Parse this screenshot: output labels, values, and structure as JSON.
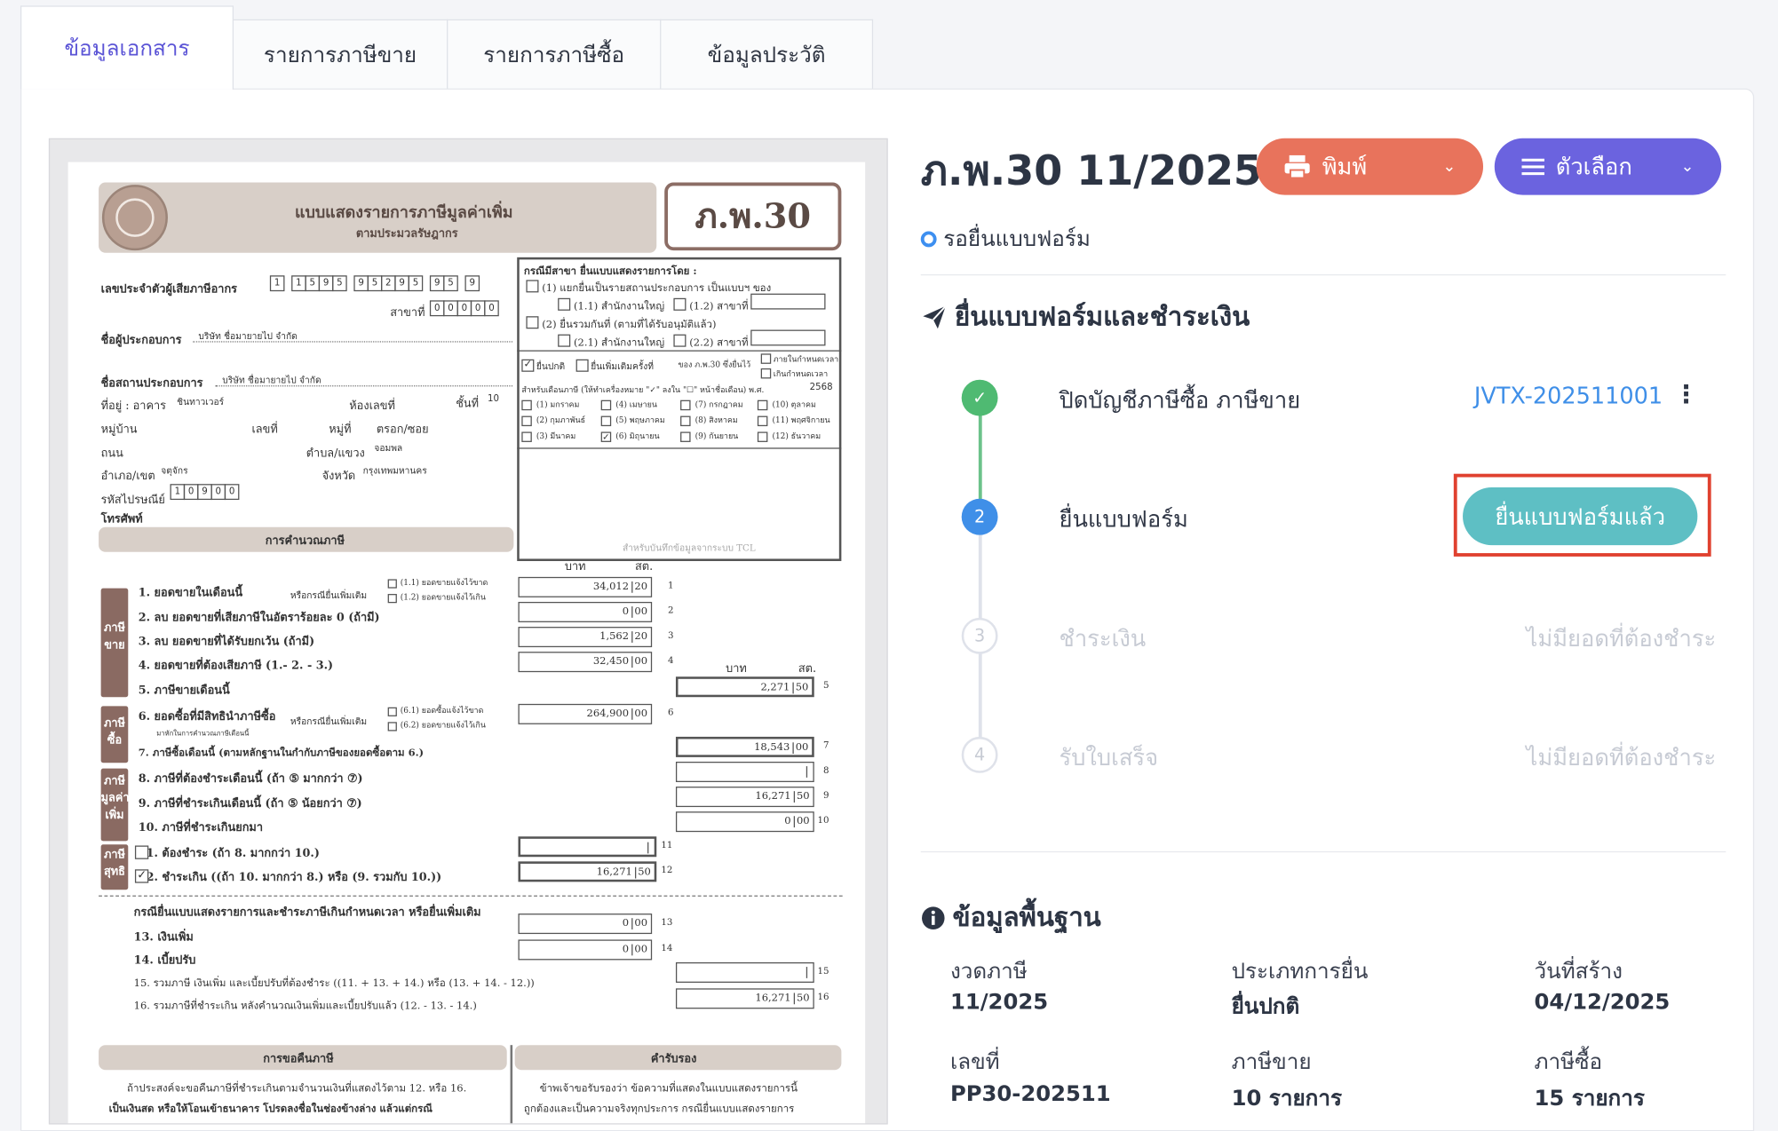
{
  "tabs": [
    "ข้อมูลเอกสาร",
    "รายการภาษีขาย",
    "รายการภาษีซื้อ",
    "ข้อมูลประวัติ"
  ],
  "doc_title": "ภ.พ.30 11/2025",
  "print_label": "พิมพ์",
  "options_label": "ตัวเลือก",
  "status": "รอยื่นแบบฟอร์ม",
  "section_submit": "ยื่นแบบฟอร์มและชำระเงิน",
  "steps": [
    {
      "num": "✓",
      "label": "ปิดบัญชีภาษีซื้อ ภาษีขาย",
      "value": "JVTX-202511001"
    },
    {
      "num": "2",
      "label": "ยื่นแบบฟอร์ม",
      "value": "ยื่นแบบฟอร์มแล้ว"
    },
    {
      "num": "3",
      "label": "ชำระเงิน",
      "value": "ไม่มียอดที่ต้องชำระ"
    },
    {
      "num": "4",
      "label": "รับใบเสร็จ",
      "value": "ไม่มียอดที่ต้องชำระ"
    }
  ],
  "section_basic": "ข้อมูลพื้นฐาน",
  "basic": [
    {
      "k": "งวดภาษี",
      "v": "11/2025"
    },
    {
      "k": "ประเภทการยื่น",
      "v": "ยื่นปกติ"
    },
    {
      "k": "วันที่สร้าง",
      "v": "04/12/2025"
    },
    {
      "k": "เลขที่",
      "v": "PP30-202511"
    },
    {
      "k": "ภาษีขาย",
      "v": "10 รายการ"
    },
    {
      "k": "ภาษีซื้อ",
      "v": "15 รายการ"
    }
  ],
  "form": {
    "header": "แบบแสดงรายการภาษีมูลค่าเพิ่ม",
    "subheader": "ตามประมวลรัษฎากร",
    "code": "ภ.พ.30",
    "taxid_label": "เลขประจำตัวผู้เสียภาษีอากร",
    "taxid": [
      "1",
      "1",
      "5",
      "9",
      "5",
      "9",
      "5",
      "2",
      "9",
      "5",
      "9",
      "5",
      "9"
    ],
    "branch_label": "สาขาที่",
    "branch": [
      "0",
      "0",
      "0",
      "0",
      "0"
    ],
    "operator_label": "ชื่อผู้ประกอบการ",
    "operator": "บริษัท ชื่อมายายไป จำกัด",
    "place_label": "ชื่อสถานประกอบการ",
    "place": "บริษัท ชื่อมายายไป จำกัด",
    "addr_building_label": "ที่อยู่ : อาคาร",
    "addr_building": "ชินทาวเวอร์",
    "room_label": "ห้องเลขที่",
    "floor_label": "ชั้นที่",
    "floor": "10",
    "village_label": "หมู่บ้าน",
    "no_label": "เลขที่",
    "moo_label": "หมู่ที่",
    "soi_label": "ตรอก/ซอย",
    "road_label": "ถนน",
    "subdistrict_label": "ตำบล/แขวง",
    "subdistrict": "จอมพล",
    "district_label": "อำเภอ/เขต",
    "district": "จตุจักร",
    "province_label": "จังหวัด",
    "province": "กรุงเทพมหานคร",
    "postal_label": "รหัสไปรษณีย์",
    "postal": [
      "1",
      "0",
      "9",
      "0",
      "0"
    ],
    "phone_label": "โทรศัพท์",
    "branch_case": "กรณีมีสาขา ยื่นแบบแสดงรายการโดย :",
    "opt1": "(1) แยกยื่นเป็นรายสถานประกอบการ เป็นแบบฯ ของ",
    "opt11": "(1.1) สำนักงานใหญ่",
    "opt12": "(1.2) สาขาที่",
    "opt2": "(2) ยื่นรวมกันที่ (ตามที่ได้รับอนุมัติแล้ว)",
    "opt21": "(2.1) สำนักงานใหญ่",
    "opt22": "(2.2) สาขาที่",
    "normal": "ยื่นปกติ",
    "extra": "ยื่นเพิ่มเติมครั้งที่",
    "pp30of": "ของ ภ.พ.30 ซึ่งยื่นไว้",
    "within": "ภายในกำหนดเวลา",
    "over": "เกินกำหนดเวลา",
    "month_hdr": "สำหรับเดือนภาษี (ให้ทำเครื่องหมาย \"✓\" ลงใน \"☐\" หน้าชื่อเดือน) พ.ศ.",
    "year": "2568",
    "months": [
      "(1) มกราคม",
      "(4) เมษายน",
      "(7) กรกฎาคม",
      "(10) ตุลาคม",
      "(2) กุมภาพันธ์",
      "(5) พฤษภาคม",
      "(8) สิงหาคม",
      "(11) พฤศจิกายน",
      "(3) มีนาคม",
      "(6) มิถุนายน",
      "(9) กันยายน",
      "(12) ธันวาคม"
    ],
    "tcl": "สำหรับบันทึกข้อมูลจากระบบ TCL",
    "calc": "การคำนวณภาษี",
    "baht": "บาท",
    "satang": "สต.",
    "side_sale": [
      "ภาษี",
      "ขาย"
    ],
    "side_buy": [
      "ภาษี",
      "ซื้อ"
    ],
    "side_vat": [
      "ภาษี",
      "มูลค่า",
      "เพิ่ม"
    ],
    "side_net": [
      "ภาษี",
      "สุทธิ"
    ],
    "or_extra": "หรือกรณียื่นเพิ่มเติม",
    "r11": "(1.1) ยอดขายแจ้งไว้ขาด",
    "r12": "(1.2) ยอดขายแจ้งไว้เกิน",
    "r61": "(6.1) ยอดซื้อแจ้งไว้ขาด",
    "r62": "(6.2) ยอดขายแจ้งไว้เกิน",
    "r6note": "มาหักในการคำนวณภาษีเดือนนี้",
    "lines": [
      "1. ยอดขายในเดือนนี้",
      "2. ลบ ยอดขายที่เสียภาษีในอัตราร้อยละ 0 (ถ้ามี)",
      "3. ลบ ยอดขายที่ได้รับยกเว้น (ถ้ามี)",
      "4. ยอดขายที่ต้องเสียภาษี (1.- 2. - 3.)",
      "5. ภาษีขายเดือนนี้",
      "6. ยอดซื้อที่มีสิทธินำภาษีซื้อ",
      "7. ภาษีซื้อเดือนนี้ (ตามหลักฐานในกำกับภาษีของยอดซื้อตาม 6.)",
      "8. ภาษีที่ต้องชำระเดือนนี้ (ถ้า ⑤ มากกว่า ⑦)",
      "9. ภาษีที่ชำระเกินเดือนนี้ (ถ้า ⑤ น้อยกว่า ⑦)",
      "10. ภาษีที่ชำระเกินยกมา",
      "11. ต้องชำระ (ถ้า 8. มากกว่า 10.)",
      "12. ชำระเกิน ((ถ้า 10. มากกว่า 8.) หรือ (9. รวมกับ 10.))"
    ],
    "vals": {
      "v1": "34,012",
      "s1": "20",
      "v2": "0",
      "s2": "00",
      "v3": "1,562",
      "s3": "20",
      "v4": "32,450",
      "s4": "00",
      "v5": "2,271",
      "s5": "50",
      "v6": "264,900",
      "s6": "00",
      "v7": "18,543",
      "s7": "00",
      "v9": "16,271",
      "s9": "50",
      "v10": "0",
      "s10": "00",
      "v12": "16,271",
      "s12": "50"
    },
    "late_hdr": "กรณียื่นแบบแสดงรายการและชำระภาษีเกินกำหนดเวลา หรือยื่นเพิ่มเติม",
    "l13": "13. เงินเพิ่ม",
    "l14": "14. เบี้ยปรับ",
    "l15": "15. รวมภาษี เงินเพิ่ม และเบี้ยปรับที่ต้องชำระ ((11. + 13. + 14.) หรือ (13. + 14. - 12.))",
    "l16": "16. รวมภาษีที่ชำระเกิน หลังคำนวณเงินเพิ่มและเบี้ยปรับแล้ว (12. - 13. - 14.)",
    "v13": "0",
    "s13": "00",
    "v14": "0",
    "s14": "00",
    "v16": "16,271",
    "s16": "50",
    "refund_hdr": "การขอคืนภาษี",
    "cert_hdr": "คำรับรอง",
    "refund_t1": "ถ้าประสงค์จะขอคืนภาษีที่ชำระเกินตามจำนวนเงินที่แสดงไว้ตาม 12. หรือ 16.",
    "refund_t2": "เป็นเงินสด หรือให้โอนเข้าธนาคาร โปรดลงชื่อในช่องข้างล่าง แล้วแต่กรณี",
    "cert_t1": "ข้าพเจ้าขอรับรองว่า ข้อความที่แสดงในแบบแสดงรายการนี้",
    "cert_t2": "ถูกต้องและเป็นความจริงทุกประการ กรณียื่นแบบแสดงรายการ"
  }
}
